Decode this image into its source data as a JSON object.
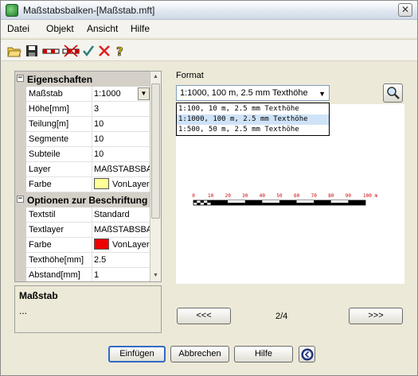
{
  "window": {
    "title": "Maßstabsbalken-[Maßstab.mft]",
    "close_glyph": "✕"
  },
  "menu": {
    "items": [
      "Datei",
      "Objekt",
      "Ansicht",
      "Hilfe"
    ]
  },
  "toolbar": {
    "icons": [
      "open-folder-icon",
      "save-icon",
      "scalebar-icon",
      "scalebar-remove-icon",
      "checkmark-icon",
      "delete-icon",
      "help-icon"
    ]
  },
  "properties": {
    "cat1": {
      "label": "Eigenschaften",
      "toggle": "−"
    },
    "rows1": [
      {
        "label": "Maßstab",
        "value": "1:1000"
      },
      {
        "label": "Höhe[mm]",
        "value": "3"
      },
      {
        "label": "Teilung[m]",
        "value": "10"
      },
      {
        "label": "Segmente",
        "value": "10"
      },
      {
        "label": "Subteile",
        "value": "10"
      },
      {
        "label": "Layer",
        "value": "MAßSTABSBA"
      },
      {
        "label": "Farbe",
        "value": "VonLayer",
        "swatch": "#ffff99"
      }
    ],
    "cat2": {
      "label": "Optionen zur Beschriftung",
      "toggle": "−"
    },
    "rows2": [
      {
        "label": "Textstil",
        "value": "Standard"
      },
      {
        "label": "Textlayer",
        "value": "MAßSTABSBA"
      },
      {
        "label": "Farbe",
        "value": "VonLayer",
        "swatch": "#ee0000"
      },
      {
        "label": "Texthöhe[mm]",
        "value": "2.5"
      },
      {
        "label": "Abstand[mm]",
        "value": "1"
      }
    ]
  },
  "description": {
    "title": "Maßstab",
    "text": "..."
  },
  "format": {
    "label": "Format",
    "selected": "1:1000, 100 m, 2.5 mm Texthöhe",
    "options": [
      "1:100, 10 m, 2.5 mm Texthöhe",
      "1:1000, 100 m, 2.5 mm Texthöhe",
      "1:500, 50 m, 2.5 mm Texthöhe"
    ],
    "highlighted_index": 1
  },
  "preview": {
    "tick_labels": [
      "0",
      "10",
      "20",
      "30",
      "40",
      "50",
      "60",
      "70",
      "80",
      "90",
      "100 m"
    ],
    "label_color": "#cc0000"
  },
  "navigation": {
    "prev": "<<<",
    "next": ">>>",
    "page": "2/4"
  },
  "buttons": {
    "insert": "Einfügen",
    "cancel": "Abbrechen",
    "help": "Hilfe"
  }
}
